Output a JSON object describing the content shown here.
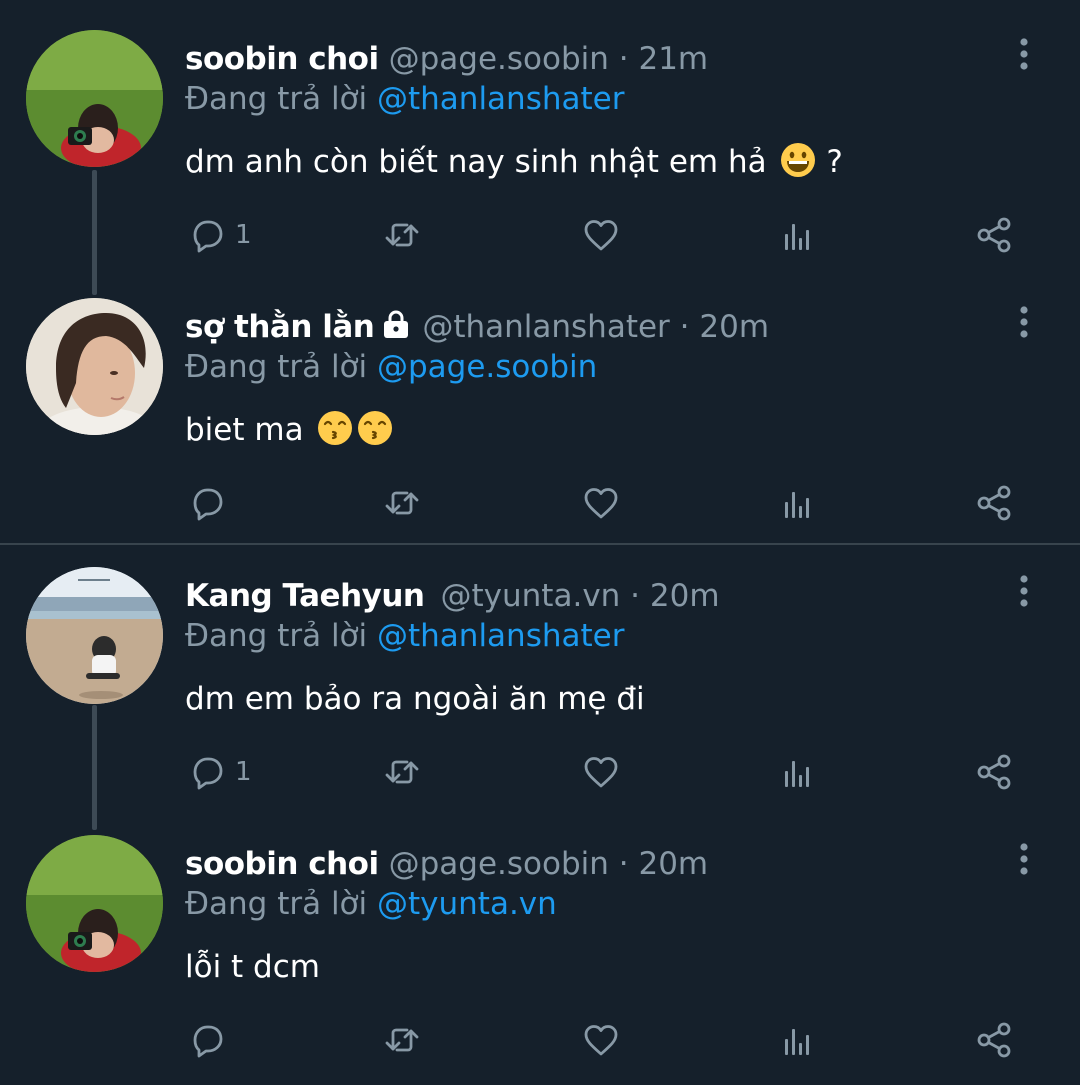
{
  "colors": {
    "background": "#15202b",
    "secondary_text": "#8899a6",
    "accent": "#1d9bf0",
    "divider": "#38444d"
  },
  "tweets": [
    {
      "author_name": "soobin choi",
      "handle": "@page.soobin",
      "separator": "·",
      "time": "21m",
      "replying_label": "Đang trả lời",
      "replying_to": "@thanlanshater",
      "text": "dm anh còn biết nay sinh nhật em hả",
      "text_suffix": "?",
      "emojis": [
        "grinning-face"
      ],
      "protected": false,
      "reply_count": "1",
      "avatar": "grass-camera"
    },
    {
      "author_name": "sợ thằn lằn",
      "handle": "@thanlanshater",
      "separator": "·",
      "time": "20m",
      "replying_label": "Đang trả lời",
      "replying_to": "@page.soobin",
      "text": "biet ma",
      "text_suffix": "",
      "emojis": [
        "kissing-face",
        "kissing-face"
      ],
      "protected": true,
      "reply_count": "",
      "avatar": "portrait"
    },
    {
      "author_name": "Kang Taehyun",
      "handle": "@tyunta.vn",
      "separator": "·",
      "time": "20m",
      "replying_label": "Đang trả lời",
      "replying_to": "@thanlanshater",
      "text": "dm em bảo ra ngoài ăn mẹ đi",
      "text_suffix": "",
      "emojis": [],
      "protected": false,
      "reply_count": "1",
      "avatar": "beach"
    },
    {
      "author_name": "soobin choi",
      "handle": "@page.soobin",
      "separator": "·",
      "time": "20m",
      "replying_label": "Đang trả lời",
      "replying_to": "@tyunta.vn",
      "text": "lỗi t dcm",
      "text_suffix": "",
      "emojis": [],
      "protected": false,
      "reply_count": "",
      "avatar": "grass-camera"
    }
  ],
  "icons": {
    "reply": "reply-icon",
    "retweet": "retweet-icon",
    "like": "heart-icon",
    "stats": "analytics-icon",
    "share": "share-icon",
    "more": "more-vertical-icon",
    "protected": "lock-icon"
  }
}
